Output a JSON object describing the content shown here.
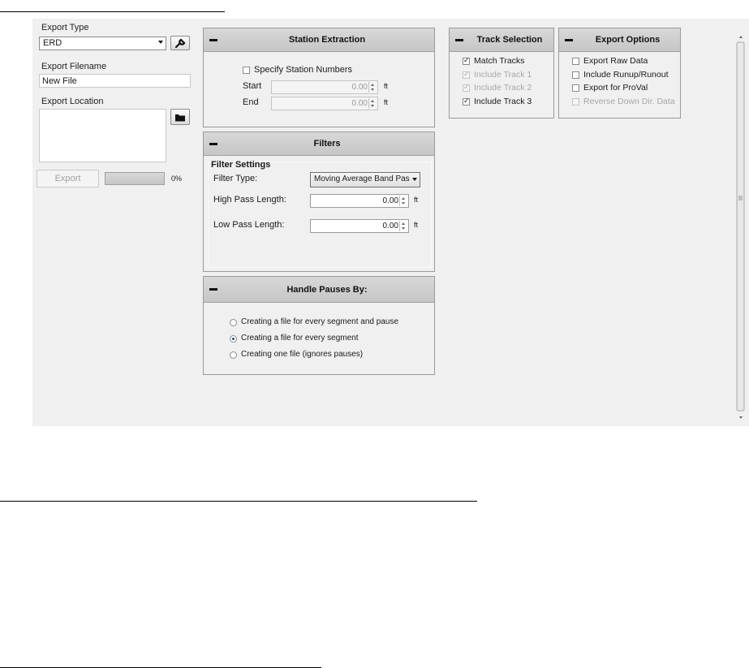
{
  "export_panel": {
    "export_type_label": "Export Type",
    "export_type_value": "ERD",
    "settings_icon": "wrench-icon",
    "export_filename_label": "Export Filename",
    "export_filename_value": "New File",
    "export_location_label": "Export Location",
    "export_location_value": "",
    "folder_icon": "folder-icon",
    "export_button": "Export",
    "progress": 0,
    "progress_text": "0%"
  },
  "station_extraction": {
    "title": "Station Extraction",
    "specify_label": "Specify Station Numbers",
    "specify_checked": false,
    "start_label": "Start",
    "start_value": "0.00",
    "end_label": "End",
    "end_value": "0.00",
    "unit": "ft"
  },
  "filters": {
    "title": "Filters",
    "settings_label": "Filter Settings",
    "type_label": "Filter Type:",
    "type_value": "Moving Average Band Pas",
    "high_label": "High Pass Length:",
    "high_value": "0.00",
    "low_label": "Low Pass Length:",
    "low_value": "0.00",
    "unit": "ft"
  },
  "pauses": {
    "title": "Handle Pauses By:",
    "options": [
      {
        "label": "Creating a file for every segment and pause",
        "selected": false
      },
      {
        "label": "Creating a file for every segment",
        "selected": true
      },
      {
        "label": "Creating one file (ignores pauses)",
        "selected": false
      }
    ]
  },
  "track_selection": {
    "title": "Track Selection",
    "items": [
      {
        "label": "Match Tracks",
        "checked": true,
        "enabled": true
      },
      {
        "label": "Include Track 1",
        "checked": true,
        "enabled": false
      },
      {
        "label": "Include Track 2",
        "checked": true,
        "enabled": false
      },
      {
        "label": "Include Track 3",
        "checked": true,
        "enabled": true
      }
    ]
  },
  "export_options": {
    "title": "Export Options",
    "items": [
      {
        "label": "Export Raw Data",
        "checked": false,
        "enabled": true
      },
      {
        "label": "Include Runup/Runout",
        "checked": false,
        "enabled": true
      },
      {
        "label": "Export for ProVal",
        "checked": false,
        "enabled": true
      },
      {
        "label": "Reverse Down Dir. Data",
        "checked": false,
        "enabled": false
      }
    ]
  },
  "colors": {
    "background": "#f0f0f0",
    "panel_header": "#c8c8c8",
    "disabled_text": "#a8a8a8"
  }
}
